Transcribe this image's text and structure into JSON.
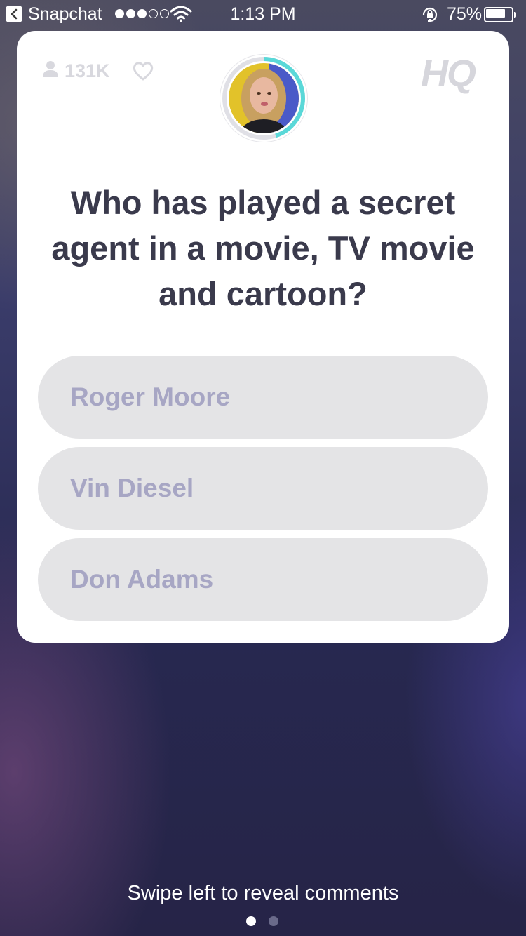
{
  "status_bar": {
    "back_app": "Snapchat",
    "time": "1:13 PM",
    "battery_percent": "75%",
    "battery_level": 0.75,
    "signal_bars": 3,
    "signal_total": 5
  },
  "card": {
    "viewer_count": "131K",
    "logo": "HQ",
    "host_icon": "host-avatar",
    "timer_progress": 0.45,
    "question": "Who has played a secret agent in a movie, TV movie and cartoon?",
    "answers": [
      {
        "label": "Roger Moore"
      },
      {
        "label": "Vin Diesel"
      },
      {
        "label": "Don Adams"
      }
    ]
  },
  "footer": {
    "swipe_hint": "Swipe left to reveal comments",
    "page_count": 2,
    "active_page": 1
  },
  "colors": {
    "card_bg": "#ffffff",
    "question_text": "#3a3a4c",
    "answer_bg": "#e4e4e6",
    "answer_text": "#a7a6c4",
    "timer_ring": "#5ad8d8"
  }
}
